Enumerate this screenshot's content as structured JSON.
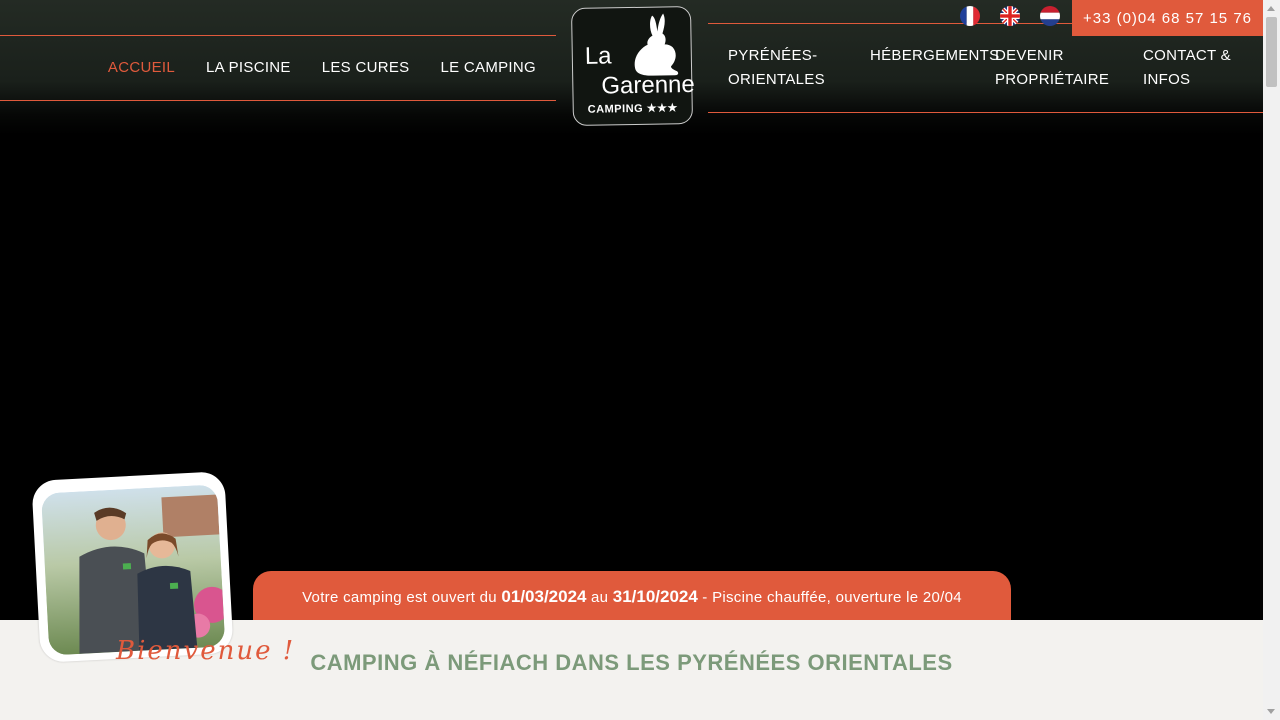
{
  "nav": {
    "left": [
      {
        "label": "Accueil",
        "active": true
      },
      {
        "label": "La piscine"
      },
      {
        "label": "Les cures"
      },
      {
        "label": "Le camping"
      }
    ],
    "right": [
      {
        "label": "Pyrénées-<br>Orientales"
      },
      {
        "label": "Hébergements"
      },
      {
        "label": "Devenir<br>propriétaire"
      },
      {
        "label": "Contact &<br>Infos"
      }
    ]
  },
  "logo": {
    "line1": "La",
    "line2": "Garenne",
    "line3": "CAMPING ★★★",
    "icon": "rabbit-icon"
  },
  "languages": [
    {
      "code": "fr",
      "icon": "flag-fr-icon"
    },
    {
      "code": "en",
      "icon": "flag-uk-icon"
    },
    {
      "code": "nl",
      "icon": "flag-nl-icon"
    }
  ],
  "phone": "+33 (0)04 68 57 15 76",
  "banner": {
    "text1": "Votre camping est ouvert du ",
    "date_open": "01/03/2024",
    "text2": " au ",
    "date_close": "31/10/2024",
    "text3": " - Piscine chauffée, ouverture le 20/04"
  },
  "section": {
    "title": "Camping à Néfiach dans les Pyrénées Orientales"
  },
  "welcome": "Bienvenue !",
  "colors": {
    "accent": "#e05a3c",
    "green_title": "#7c9a7a",
    "header_bg": "#1f261f"
  }
}
